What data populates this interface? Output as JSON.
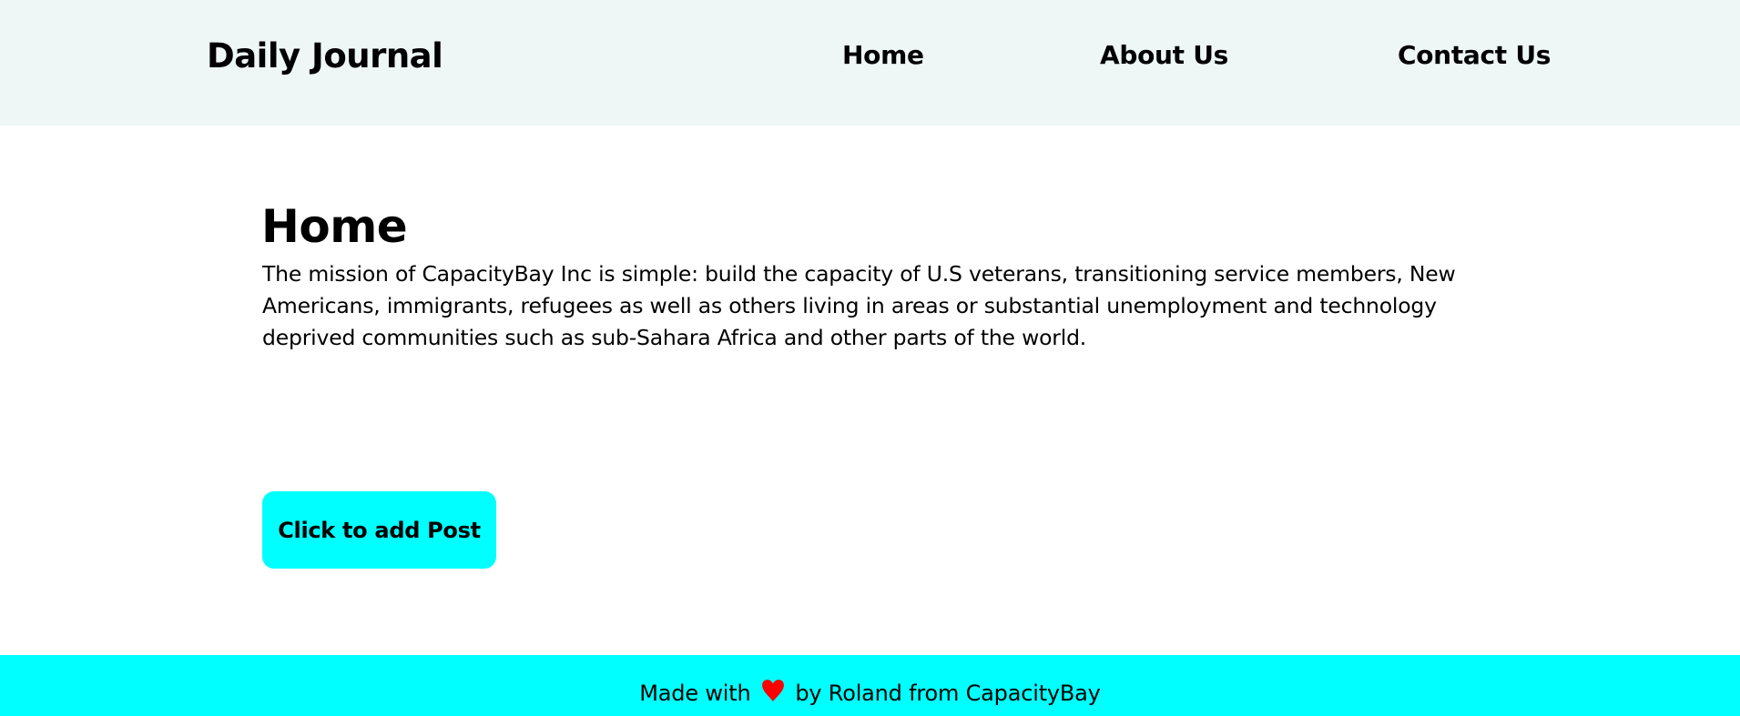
{
  "header": {
    "brand": "Daily Journal",
    "nav": [
      {
        "label": "Home"
      },
      {
        "label": "About Us"
      },
      {
        "label": "Contact Us"
      }
    ]
  },
  "main": {
    "title": "Home",
    "mission": "The mission of CapacityBay Inc is simple: build the capacity of U.S veterans, transitioning service members, New Americans, immigrants, refugees as well as others living in areas or substantial unemployment and technology deprived communities such as sub-Sahara Africa and other parts of the world.",
    "add_post_label": "Click to add Post"
  },
  "footer": {
    "text_before": "Made with",
    "icon": "heart-icon",
    "text_after": "by Roland from CapacityBay"
  },
  "colors": {
    "header_bg": "#eef6f6",
    "accent": "#00ffff",
    "heart": "#ff0000"
  }
}
